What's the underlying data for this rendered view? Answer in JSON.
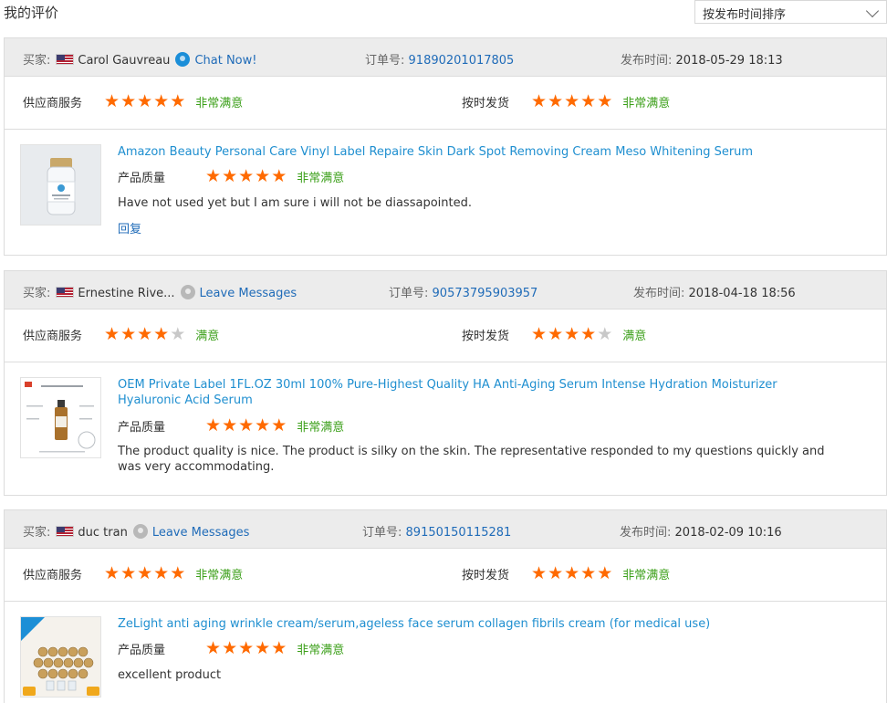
{
  "page_title": "我的评价",
  "sort": {
    "selected": "按发布时间排序"
  },
  "labels": {
    "buyer": "买家:",
    "order_no": "订单号:",
    "published": "发布时间:",
    "supplier_service": "供应商服务",
    "on_time_delivery": "按时发货",
    "product_quality": "产品质量",
    "reply": "回复"
  },
  "colors": {
    "star": "#ff6a00",
    "rating_text": "#3ca01a",
    "link": "#1f6bb8",
    "title": "#1f8fd0"
  },
  "reviews": [
    {
      "buyer_name": "Carol Gauvreau",
      "country_flag": "us-flag",
      "contact_label": "Chat Now!",
      "contact_icon": "chat-online-icon",
      "order_no": "91890201017805",
      "published_time": "2018-05-29 18:13",
      "supplier_service": {
        "stars": 5,
        "text": "非常满意"
      },
      "on_time_delivery": {
        "stars": 5,
        "text": "非常满意"
      },
      "product_title": "Amazon Beauty Personal Care Vinyl Label Repaire Skin Dark Spot Removing Cream Meso Whitening Serum",
      "product_quality": {
        "stars": 5,
        "text": "非常满意"
      },
      "comment": "Have not used yet but I am sure i will not be diassapointed.",
      "has_reply": true
    },
    {
      "buyer_name": "Ernestine Rive...",
      "country_flag": "us-flag",
      "contact_label": "Leave Messages",
      "contact_icon": "chat-offline-icon",
      "order_no": "90573795903957",
      "published_time": "2018-04-18 18:56",
      "supplier_service": {
        "stars": 4,
        "text": "满意"
      },
      "on_time_delivery": {
        "stars": 4,
        "text": "满意"
      },
      "product_title": "OEM Private Label 1FL.OZ 30ml 100% Pure-Highest Quality HA Anti-Aging Serum Intense Hydration Moisturizer Hyaluronic Acid Serum",
      "product_quality": {
        "stars": 5,
        "text": "非常满意"
      },
      "comment": "The product quality is nice. The product is silky on the skin. The representative responded to my questions quickly and was very accommodating.",
      "has_reply": false
    },
    {
      "buyer_name": "duc tran",
      "country_flag": "us-flag",
      "contact_label": "Leave Messages",
      "contact_icon": "chat-offline-icon",
      "order_no": "89150150115281",
      "published_time": "2018-02-09 10:16",
      "supplier_service": {
        "stars": 5,
        "text": "非常满意"
      },
      "on_time_delivery": {
        "stars": 5,
        "text": "非常满意"
      },
      "product_title": "ZeLight anti aging wrinkle cream/serum,ageless face serum collagen fibrils cream (for medical use)",
      "product_quality": {
        "stars": 5,
        "text": "非常满意"
      },
      "comment": "excellent product",
      "has_reply": false
    }
  ]
}
